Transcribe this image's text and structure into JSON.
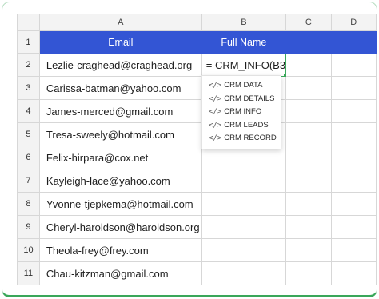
{
  "columns": [
    "A",
    "B",
    "C",
    "D"
  ],
  "header_row": {
    "row_number": "1",
    "email": "Email",
    "full_name": "Full Name"
  },
  "formula_cell": {
    "value": "= CRM_INFO(B3"
  },
  "rows": [
    {
      "n": "2",
      "email": "Lezlie-craghead@craghead.org"
    },
    {
      "n": "3",
      "email": "Carissa-batman@yahoo.com"
    },
    {
      "n": "4",
      "email": "James-merced@gmail.com"
    },
    {
      "n": "5",
      "email": "Tresa-sweely@hotmail.com"
    },
    {
      "n": "6",
      "email": "Felix-hirpara@cox.net"
    },
    {
      "n": "7",
      "email": "Kayleigh-lace@yahoo.com"
    },
    {
      "n": "8",
      "email": "Yvonne-tjepkema@hotmail.com"
    },
    {
      "n": "9",
      "email": "Cheryl-haroldson@haroldson.org"
    },
    {
      "n": "10",
      "email": "Theola-frey@frey.com"
    },
    {
      "n": "11",
      "email": "Chau-kitzman@gmail.com"
    }
  ],
  "autocomplete": {
    "icon": "</>",
    "items": [
      "CRM DATA",
      "CRM DETAILS",
      "CRM INFO",
      "CRM LEADS",
      "CRM RECORD"
    ]
  },
  "colors": {
    "header_fill": "#3355d4",
    "active_border": "#3aa75a",
    "frame_border": "#3aa75a"
  }
}
